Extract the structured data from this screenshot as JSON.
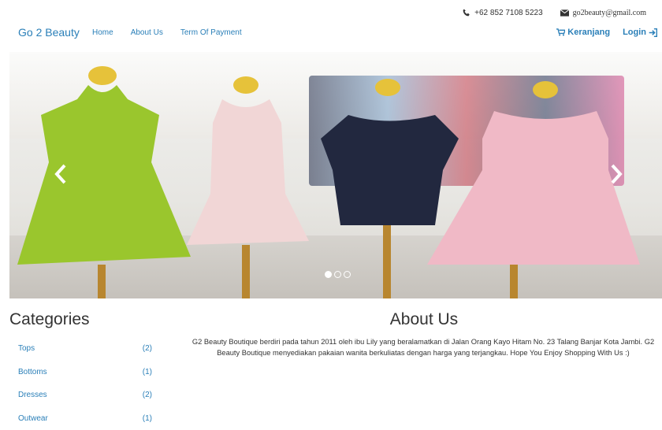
{
  "contact": {
    "phone": "+62 852 7108 5223",
    "email": "go2beauty@gmail.com"
  },
  "navbar": {
    "brand": "Go 2 Beauty",
    "links": [
      "Home",
      "About Us",
      "Term Of Payment"
    ],
    "cart": "Keranjang",
    "login": "Login"
  },
  "carousel": {
    "slide_count": 3,
    "active_index": 0
  },
  "categories": {
    "title": "Categories",
    "items": [
      {
        "label": "Tops",
        "count": "(2)"
      },
      {
        "label": "Bottoms",
        "count": "(1)"
      },
      {
        "label": "Dresses",
        "count": "(2)"
      },
      {
        "label": "Outwear",
        "count": "(1)"
      }
    ]
  },
  "about": {
    "title": "About Us",
    "paragraph": "G2 Beauty Boutique berdiri pada tahun 2011 oleh ibu Lily yang beralamatkan di Jalan Orang Kayo Hitam No. 23 Talang Banjar Kota Jambi. G2 Beauty Boutique menyediakan pakaian wanita berkuliatas dengan harga yang terjangkau. Hope You Enjoy Shopping With Us :)"
  },
  "colors": {
    "link": "#2a7fb8",
    "text": "#333333"
  },
  "icons": [
    "phone-icon",
    "envelope-icon",
    "cart-icon",
    "login-icon",
    "chevron-left-icon",
    "chevron-right-icon"
  ]
}
